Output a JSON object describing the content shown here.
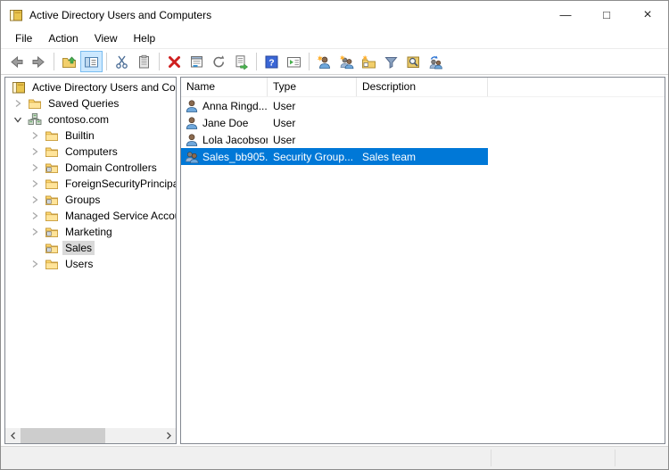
{
  "window": {
    "title": "Active Directory Users and Computers",
    "controls": {
      "minimize": "—",
      "maximize": "□",
      "close": "×"
    }
  },
  "menu": {
    "items": [
      "File",
      "Action",
      "View",
      "Help"
    ]
  },
  "toolbar": {
    "help_glyph": "?",
    "icons": [
      "back-icon",
      "forward-icon",
      "up-one-level-icon",
      "show-console-tree-icon",
      "cut-icon",
      "paste-icon",
      "delete-icon",
      "properties-icon",
      "refresh-icon",
      "export-list-icon",
      "help-icon",
      "show-window-icon",
      "new-user-icon",
      "new-group-icon",
      "new-ou-icon",
      "filter-icon",
      "find-icon",
      "refresh-membership-icon"
    ],
    "active_button": "show-console-tree",
    "active_bg": "#cce8ff"
  },
  "tree": {
    "items": [
      {
        "label": "Active Directory Users and Computers",
        "level": 0,
        "icon": "console-root",
        "chevron": null,
        "selected": false
      },
      {
        "label": "Saved Queries",
        "level": 1,
        "icon": "folder",
        "chevron": "collapsed",
        "selected": false
      },
      {
        "label": "contoso.com",
        "level": 1,
        "icon": "domain",
        "chevron": "expanded",
        "selected": false
      },
      {
        "label": "Builtin",
        "level": 2,
        "icon": "folder",
        "chevron": "collapsed",
        "selected": false
      },
      {
        "label": "Computers",
        "level": 2,
        "icon": "folder",
        "chevron": "collapsed",
        "selected": false
      },
      {
        "label": "Domain Controllers",
        "level": 2,
        "icon": "ou-folder",
        "chevron": "collapsed",
        "selected": false
      },
      {
        "label": "ForeignSecurityPrincipals",
        "level": 2,
        "icon": "folder",
        "chevron": "collapsed",
        "selected": false
      },
      {
        "label": "Groups",
        "level": 2,
        "icon": "ou-folder",
        "chevron": "collapsed",
        "selected": false
      },
      {
        "label": "Managed Service Accounts",
        "level": 2,
        "icon": "folder",
        "chevron": "collapsed",
        "selected": false
      },
      {
        "label": "Marketing",
        "level": 2,
        "icon": "ou-folder",
        "chevron": "collapsed",
        "selected": false
      },
      {
        "label": "Sales",
        "level": 2,
        "icon": "ou-folder",
        "chevron": null,
        "selected": true
      },
      {
        "label": "Users",
        "level": 2,
        "icon": "folder",
        "chevron": "collapsed",
        "selected": false
      }
    ]
  },
  "list": {
    "columns": [
      "Name",
      "Type",
      "Description"
    ],
    "rows": [
      {
        "name": "Anna Ringd...",
        "type": "User",
        "desc": "",
        "icon": "user",
        "selected": false
      },
      {
        "name": "Jane Doe",
        "type": "User",
        "desc": "",
        "icon": "user",
        "selected": false
      },
      {
        "name": "Lola Jacobson",
        "type": "User",
        "desc": "",
        "icon": "user",
        "selected": false
      },
      {
        "name": "Sales_bb905...",
        "type": "Security Group...",
        "desc": "Sales team",
        "icon": "group",
        "selected": true
      }
    ]
  },
  "colors": {
    "selection": "#0078d7",
    "inactive_selection": "#d9d9d9",
    "folder": "#ffd86f",
    "pane_border": "#828790"
  }
}
